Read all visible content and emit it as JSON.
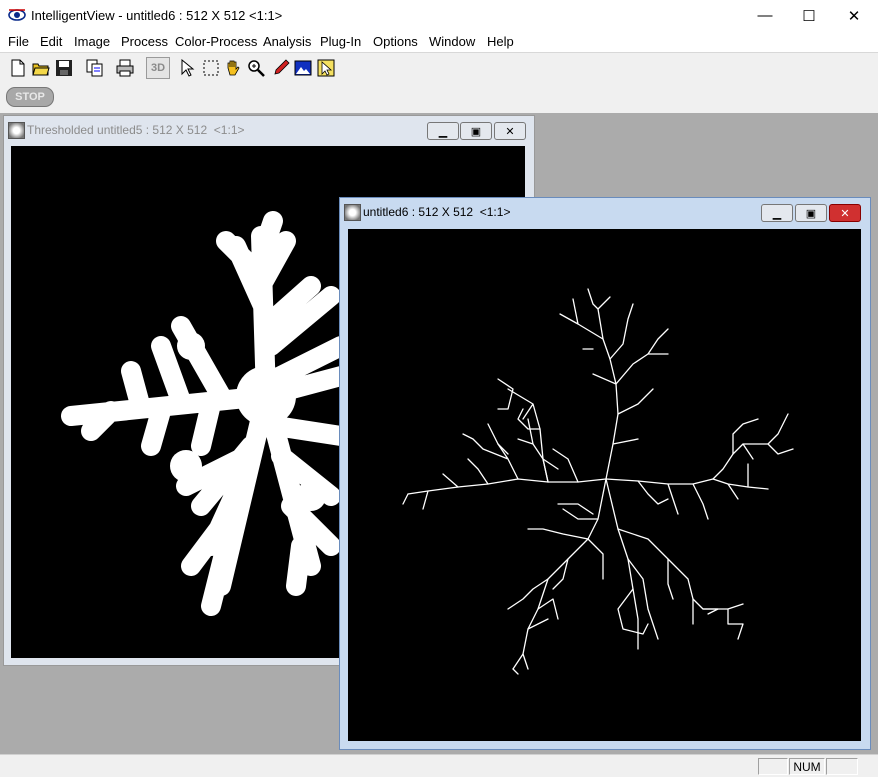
{
  "app": {
    "title": "IntelligentView - untitled6 : 512 X 512  <1:1>",
    "minimize_glyph": "—",
    "maximize_glyph": "☐",
    "close_glyph": "✕"
  },
  "menu": [
    "File",
    "Edit",
    "Image",
    "Process",
    "Color-Process",
    "Analysis",
    "Plug-In",
    "Options",
    "Window",
    "Help"
  ],
  "toolbar": {
    "tools": [
      "new-file-icon",
      "open-folder-icon",
      "save-disk-icon",
      "copy-icon",
      "print-icon",
      "3d-icon",
      "pointer-icon",
      "marquee-select-icon",
      "hand-pan-icon",
      "zoom-icon",
      "pen-icon",
      "image-icon",
      "flag-pointer-icon"
    ],
    "three_d_label": "3D",
    "stop_label": "STOP"
  },
  "windows": {
    "thresholded": {
      "title": "Thresholded untitled5 : 512 X 512  <1:1>",
      "active": false
    },
    "untitled6": {
      "title": "untitled6 : 512 X 512  <1:1>",
      "active": true
    }
  },
  "status": {
    "num": "NUM"
  }
}
